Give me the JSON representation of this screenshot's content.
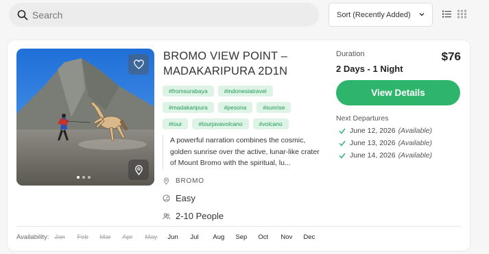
{
  "search": {
    "placeholder": "Search"
  },
  "sort": {
    "label": "Sort (Recently Added)"
  },
  "tour": {
    "title": "BROMO VIEW POINT – MADAKARIPURA 2D1N",
    "tags": [
      "#fromsurabaya",
      "#indonesiatravel",
      "#madakaripura",
      "#pesona",
      "#sunrise",
      "#tour",
      "#tourjavavolcano",
      "#volcano"
    ],
    "description": "A powerful narration combines the cosmic, golden sunrise over the active, lunar-like crater of Mount Bromo with the spiritual, lu...",
    "location": "BROMO",
    "difficulty": "Easy",
    "group_size": "2-10 People",
    "duration_label": "Duration",
    "duration_value": "2 Days - 1 Night",
    "price": "$76",
    "cta": "View Details",
    "next_departures_label": "Next Departures",
    "departures": [
      {
        "date": "June 12, 2026",
        "status": "(Available)"
      },
      {
        "date": "June 13, 2026",
        "status": "(Available)"
      },
      {
        "date": "June 14, 2026",
        "status": "(Available)"
      }
    ],
    "availability_label": "Availability:",
    "months": [
      {
        "name": "Jan",
        "available": false
      },
      {
        "name": "Feb",
        "available": false
      },
      {
        "name": "Mar",
        "available": false
      },
      {
        "name": "Apr",
        "available": false
      },
      {
        "name": "May",
        "available": false
      },
      {
        "name": "Jun",
        "available": true
      },
      {
        "name": "Jul",
        "available": true
      },
      {
        "name": "Aug",
        "available": true
      },
      {
        "name": "Sep",
        "available": true
      },
      {
        "name": "Oct",
        "available": true
      },
      {
        "name": "Nov",
        "available": true
      },
      {
        "name": "Dec",
        "available": true
      }
    ],
    "gallery_slides": 3,
    "gallery_active": 0
  },
  "colors": {
    "accent": "#2fb56b",
    "tag_bg": "#dcf3e5",
    "tag_text": "#239a55"
  }
}
